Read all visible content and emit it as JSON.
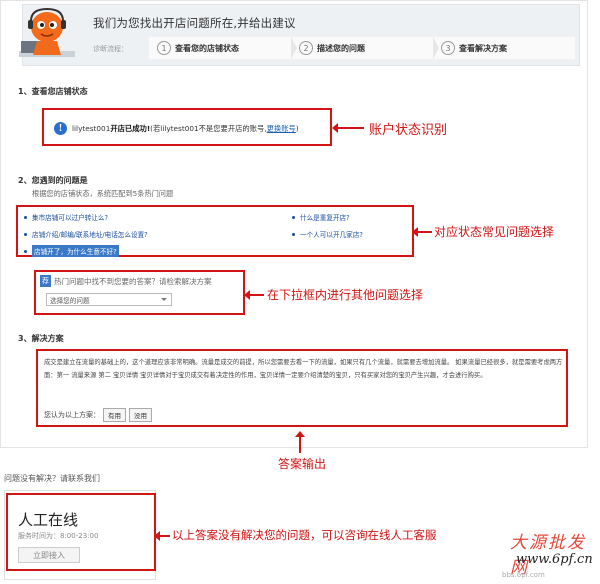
{
  "header": {
    "title": "我们为您找出开店问题所在,并给出建议",
    "flow_label": "诊断流程：",
    "steps": [
      {
        "num": "1",
        "label": "查看您的店铺状态"
      },
      {
        "num": "2",
        "label": "描述您的问题"
      },
      {
        "num": "3",
        "label": "查看解决方案"
      }
    ]
  },
  "section1": {
    "title": "1、查看您店铺状态",
    "account": "lilytest001",
    "success": "开店已成功!",
    "note": "(若lilytest001不是您要开店的账号,",
    "switch_link": "更换账号",
    "note_end": ")",
    "callout": "账户状态识别"
  },
  "section2": {
    "title": "2、您遇到的问题是",
    "subtitle": "根据您的店铺状态，系统匹配到5条热门问题",
    "questions": [
      "集市店铺可以过户转让么?",
      "店铺介绍/邮编/联系地址/电话怎么设置?",
      "店铺开了，为什么生意不好?",
      "什么是重复开店?",
      "一个人可以开几家店?"
    ],
    "callout": "对应状态常见问题选择",
    "tip_badge": "荐",
    "tip_text": "热门问题中找不到您要的答案？请检索解决方案",
    "select_value": "选择您的问题",
    "select_callout": "在下拉框内进行其他问题选择"
  },
  "section3": {
    "title": "3、解决方案",
    "answer": "成交是建立在流量的基础上的，这个道理应该非常明确。流量是成交的前提，所以您需要去看一下的流量，如果只有几个流量，就需要去增加流量。 如果流量已经很多，就是需要考虑两方面：第一 流量来源 第二 宝贝详情 宝贝详情对于宝贝成交有着决定性的作用，宝贝详情一定要介绍清楚的宝贝，只有买家对您的宝贝产生兴趣，才会进行购买。",
    "vote_prompt": "您认为以上方案：",
    "vote_yes": "有用",
    "vote_no": "没用",
    "callout": "答案输出"
  },
  "help": {
    "unresolved": "问题没有解决？请联系我们",
    "online_title": "人工在线",
    "online_hours": "服务时间为：8:00-23:00",
    "online_button": "立即接入",
    "callout": "以上答案没有解决您的问题，可以咨询在线人工客服"
  },
  "watermark": {
    "text_cn": "大源批发网",
    "url": "www.6pf.cn",
    "url2": "bbs.6pf.com"
  },
  "colors": {
    "annotation_red": "#d21414",
    "link_blue": "#1a4fa0",
    "highlight_blue": "#3a78c8"
  }
}
